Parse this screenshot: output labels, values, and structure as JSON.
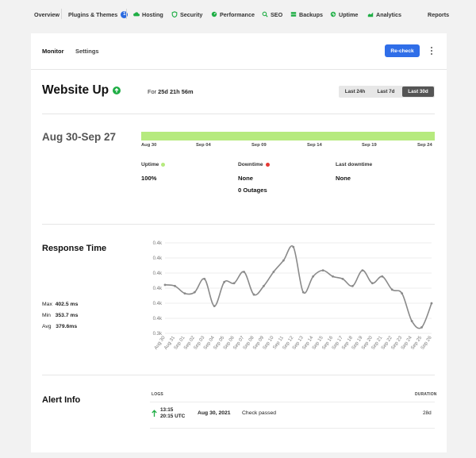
{
  "nav": {
    "items": [
      {
        "label": "Overview",
        "icon": "none"
      },
      {
        "label": "Plugins & Themes",
        "icon": "none",
        "badge": "1"
      },
      {
        "label": "Hosting",
        "icon": "cloud-icon"
      },
      {
        "label": "Security",
        "icon": "shield-icon"
      },
      {
        "label": "Performance",
        "icon": "gauge-icon"
      },
      {
        "label": "SEO",
        "icon": "search-icon"
      },
      {
        "label": "Backups",
        "icon": "backup-icon"
      },
      {
        "label": "Uptime",
        "icon": "uptime-icon"
      },
      {
        "label": "Analytics",
        "icon": "chart-icon"
      },
      {
        "label": "Reports",
        "icon": "none"
      }
    ]
  },
  "tabs": {
    "monitor": "Monitor",
    "settings": "Settings"
  },
  "toolbar": {
    "recheck_label": "Re-check"
  },
  "status": {
    "title": "Website Up",
    "duration": "25d 21h 56m",
    "duration_prefix": "For",
    "ranges": [
      "Last 24h",
      "Last 7d",
      "Last 30d"
    ],
    "active_range": "Last 30d"
  },
  "uptime_section": {
    "period": "Aug 30-Sep 27",
    "ticks": [
      "Aug 30",
      "Sep 04",
      "Sep 09",
      "Sep 14",
      "Sep 19",
      "Sep 24"
    ],
    "uptime_label": "Uptime",
    "uptime_value": "100%",
    "downtime_label": "Downtime",
    "downtime_value": "None",
    "outages": "0 Outages",
    "last_downtime_label": "Last downtime",
    "last_downtime_value": "None"
  },
  "response": {
    "title": "Response Time",
    "max_label": "Max",
    "max_value": "402.5 ms",
    "min_label": "Min",
    "min_value": "353.7 ms",
    "avg_label": "Avg",
    "avg_value": "379.6ms"
  },
  "chart_data": {
    "type": "line",
    "title": "",
    "xlabel": "",
    "ylabel": "",
    "y_tick_labels": [
      "0.4k",
      "0.4k",
      "0.4k",
      "0.4k",
      "0.4k",
      "0.4k",
      "0.3k"
    ],
    "ylim": [
      350,
      405
    ],
    "grid": true,
    "categories": [
      "Aug 30",
      "Aug 31",
      "Sep 01",
      "Sep 02",
      "Sep 03",
      "Sep 04",
      "Sep 05",
      "Sep 06",
      "Sep 07",
      "Sep 08",
      "Sep 09",
      "Sep 10",
      "Sep 11",
      "Sep 12",
      "Sep 13",
      "Sep 14",
      "Sep 15",
      "Sep 16",
      "Sep 17",
      "Sep 18",
      "Sep 19",
      "Sep 20",
      "Sep 21",
      "Sep 22",
      "Sep 23",
      "Sep 24",
      "Sep 25",
      "Sep 26"
    ],
    "series": [
      {
        "values": [
          379.5,
          378.8,
          374.3,
          375.0,
          383.1,
          366.6,
          381.2,
          380.5,
          387.4,
          373.6,
          378.8,
          387.4,
          394.3,
          402.5,
          375.0,
          384.6,
          388.3,
          384.6,
          383.1,
          378.8,
          388.3,
          380.5,
          384.6,
          376.6,
          374.3,
          357.5,
          353.7,
          368.3
        ]
      }
    ]
  },
  "alerts": {
    "title": "Alert Info",
    "logs_header": "LOGS",
    "duration_header": "DURATION",
    "rows": [
      {
        "time1": "13:15",
        "time2": "20:15 UTC",
        "date": "Aug 30, 2021",
        "message": "Check passed",
        "duration": "28d"
      }
    ]
  },
  "colors": {
    "accent": "#2f6ee8",
    "up_green": "#1fae45",
    "uptime_bar": "#b6ea7e",
    "uptime_dot": "#b6ea7e",
    "downtime_dot": "#e53935",
    "line": "#8a8a8a"
  }
}
